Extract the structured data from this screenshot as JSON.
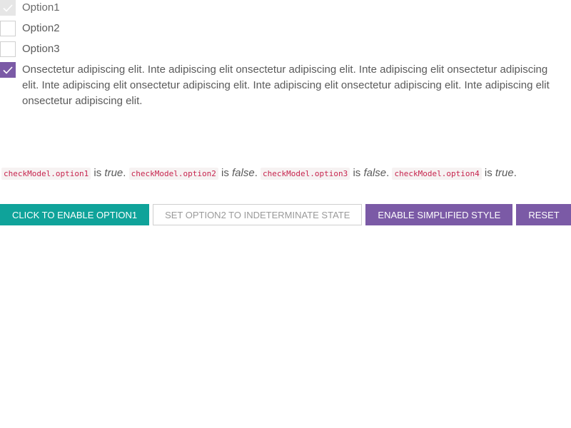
{
  "checkboxes": [
    {
      "label": "Option1",
      "state": "checked-disabled"
    },
    {
      "label": "Option2",
      "state": "unchecked"
    },
    {
      "label": "Option3",
      "state": "unchecked"
    },
    {
      "label": "Onsectetur adipiscing elit. Inte adipiscing elit onsectetur adipiscing elit. Inte adipiscing elit onsectetur adipiscing elit. Inte adipiscing elit onsectetur adipiscing elit. Inte adipiscing elit onsectetur adipiscing elit. Inte adipiscing elit onsectetur adipiscing elit.",
      "state": "checked"
    }
  ],
  "status": {
    "is_word": "is",
    "items": [
      {
        "code": "checkModel.option1",
        "value": "true"
      },
      {
        "code": "checkModel.option2",
        "value": "false"
      },
      {
        "code": "checkModel.option3",
        "value": "false"
      },
      {
        "code": "checkModel.option4",
        "value": "true"
      }
    ]
  },
  "buttons": {
    "enable_option1": "CLICK TO ENABLE OPTION1",
    "set_indeterminate": "SET OPTION2 TO INDETERMINATE STATE",
    "simplified_style": "ENABLE SIMPLIFIED STYLE",
    "reset": "RESET"
  },
  "colors": {
    "teal": "#0fa39a",
    "purple": "#7b5aa6",
    "code_text": "#c7254e"
  }
}
